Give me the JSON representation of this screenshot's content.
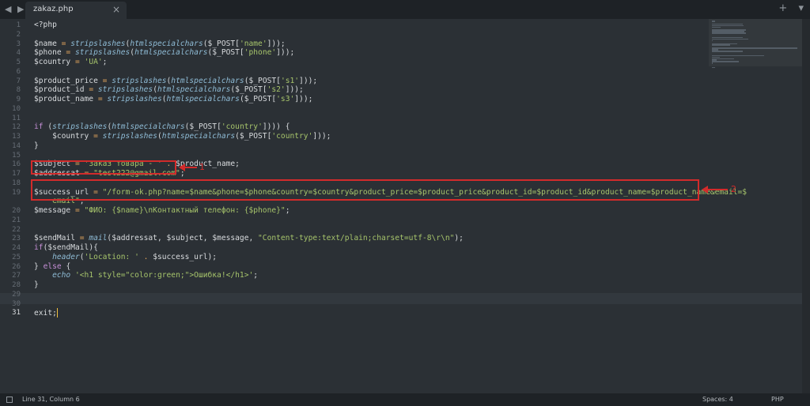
{
  "tab": {
    "filename": "zakaz.php",
    "close": "×",
    "nav": "◀ ▶"
  },
  "tab_actions": {
    "add": "+",
    "menu": "▾"
  },
  "code": {
    "lines": [
      {
        "n": "1",
        "tokens": [
          {
            "t": "<?php",
            "c": "v"
          }
        ]
      },
      {
        "n": "2",
        "tokens": []
      },
      {
        "n": "3",
        "tokens": [
          {
            "t": "$name",
            "c": "v"
          },
          {
            "t": " = ",
            "c": "o"
          },
          {
            "t": "stripslashes",
            "c": "f"
          },
          {
            "t": "(",
            "c": "v"
          },
          {
            "t": "htmlspecialchars",
            "c": "f"
          },
          {
            "t": "($_POST[",
            "c": "v"
          },
          {
            "t": "'name'",
            "c": "s"
          },
          {
            "t": "]));",
            "c": "v"
          }
        ]
      },
      {
        "n": "4",
        "tokens": [
          {
            "t": "$phone",
            "c": "v"
          },
          {
            "t": " = ",
            "c": "o"
          },
          {
            "t": "stripslashes",
            "c": "f"
          },
          {
            "t": "(",
            "c": "v"
          },
          {
            "t": "htmlspecialchars",
            "c": "f"
          },
          {
            "t": "($_POST[",
            "c": "v"
          },
          {
            "t": "'phone'",
            "c": "s"
          },
          {
            "t": "]));",
            "c": "v"
          }
        ]
      },
      {
        "n": "5",
        "tokens": [
          {
            "t": "$country",
            "c": "v"
          },
          {
            "t": " = ",
            "c": "o"
          },
          {
            "t": "'UA'",
            "c": "s"
          },
          {
            "t": ";",
            "c": "v"
          }
        ]
      },
      {
        "n": "6",
        "tokens": []
      },
      {
        "n": "7",
        "tokens": [
          {
            "t": "$product_price",
            "c": "v"
          },
          {
            "t": " = ",
            "c": "o"
          },
          {
            "t": "stripslashes",
            "c": "f"
          },
          {
            "t": "(",
            "c": "v"
          },
          {
            "t": "htmlspecialchars",
            "c": "f"
          },
          {
            "t": "($_POST[",
            "c": "v"
          },
          {
            "t": "'s1'",
            "c": "s"
          },
          {
            "t": "]));",
            "c": "v"
          }
        ]
      },
      {
        "n": "8",
        "tokens": [
          {
            "t": "$product_id",
            "c": "v"
          },
          {
            "t": " = ",
            "c": "o"
          },
          {
            "t": "stripslashes",
            "c": "f"
          },
          {
            "t": "(",
            "c": "v"
          },
          {
            "t": "htmlspecialchars",
            "c": "f"
          },
          {
            "t": "($_POST[",
            "c": "v"
          },
          {
            "t": "'s2'",
            "c": "s"
          },
          {
            "t": "]));",
            "c": "v"
          }
        ]
      },
      {
        "n": "9",
        "tokens": [
          {
            "t": "$product_name",
            "c": "v"
          },
          {
            "t": " = ",
            "c": "o"
          },
          {
            "t": "stripslashes",
            "c": "f"
          },
          {
            "t": "(",
            "c": "v"
          },
          {
            "t": "htmlspecialchars",
            "c": "f"
          },
          {
            "t": "($_POST[",
            "c": "v"
          },
          {
            "t": "'s3'",
            "c": "s"
          },
          {
            "t": "]));",
            "c": "v"
          }
        ]
      },
      {
        "n": "10",
        "tokens": []
      },
      {
        "n": "11",
        "tokens": []
      },
      {
        "n": "12",
        "tokens": [
          {
            "t": "if",
            "c": "k"
          },
          {
            "t": " (",
            "c": "v"
          },
          {
            "t": "stripslashes",
            "c": "f"
          },
          {
            "t": "(",
            "c": "v"
          },
          {
            "t": "htmlspecialchars",
            "c": "f"
          },
          {
            "t": "($_POST[",
            "c": "v"
          },
          {
            "t": "'country'",
            "c": "s"
          },
          {
            "t": "]))) {",
            "c": "v"
          }
        ]
      },
      {
        "n": "13",
        "tokens": [
          {
            "t": "    $country",
            "c": "v"
          },
          {
            "t": " = ",
            "c": "o"
          },
          {
            "t": "stripslashes",
            "c": "f"
          },
          {
            "t": "(",
            "c": "v"
          },
          {
            "t": "htmlspecialchars",
            "c": "f"
          },
          {
            "t": "($_POST[",
            "c": "v"
          },
          {
            "t": "'country'",
            "c": "s"
          },
          {
            "t": "]));",
            "c": "v"
          }
        ]
      },
      {
        "n": "14",
        "tokens": [
          {
            "t": "}",
            "c": "v"
          }
        ]
      },
      {
        "n": "15",
        "tokens": []
      },
      {
        "n": "16",
        "tokens": [
          {
            "t": "$subject",
            "c": "v"
          },
          {
            "t": " = ",
            "c": "o"
          },
          {
            "t": "'Заказ товара - '",
            "c": "s"
          },
          {
            "t": " . ",
            "c": "o"
          },
          {
            "t": "$product_name;",
            "c": "v"
          }
        ]
      },
      {
        "n": "17",
        "tokens": [
          {
            "t": "$addressat",
            "c": "v"
          },
          {
            "t": " = ",
            "c": "o"
          },
          {
            "t": "\"test222@gmail.com\"",
            "c": "s"
          },
          {
            "t": ";",
            "c": "v"
          }
        ]
      },
      {
        "n": "18",
        "tokens": []
      },
      {
        "n": "19",
        "tokens": [
          {
            "t": "$success_url",
            "c": "v"
          },
          {
            "t": " = ",
            "c": "o"
          },
          {
            "t": "\"/form-ok.php?name=$name&phone=$phone&country=$country&product_price=$product_price&product_id=$product_id&product_name=$product_name&email=$",
            "c": "s"
          }
        ]
      },
      {
        "n": "",
        "tokens": [
          {
            "t": "    email\"",
            "c": "s"
          },
          {
            "t": ";",
            "c": "v"
          }
        ]
      },
      {
        "n": "20",
        "tokens": [
          {
            "t": "$message",
            "c": "v"
          },
          {
            "t": " = ",
            "c": "o"
          },
          {
            "t": "\"ФИО: {$name}\\nКонтактный телефон: {$phone}\"",
            "c": "s"
          },
          {
            "t": ";",
            "c": "v"
          }
        ]
      },
      {
        "n": "21",
        "tokens": []
      },
      {
        "n": "22",
        "tokens": []
      },
      {
        "n": "23",
        "tokens": [
          {
            "t": "$sendMail",
            "c": "v"
          },
          {
            "t": " = ",
            "c": "o"
          },
          {
            "t": "mail",
            "c": "f"
          },
          {
            "t": "($addressat, $subject, $message, ",
            "c": "v"
          },
          {
            "t": "\"Content-type:text/plain;charset=utf-8\\r\\n\"",
            "c": "s"
          },
          {
            "t": ");",
            "c": "v"
          }
        ]
      },
      {
        "n": "24",
        "tokens": [
          {
            "t": "if",
            "c": "k"
          },
          {
            "t": "($sendMail){",
            "c": "v"
          }
        ]
      },
      {
        "n": "25",
        "tokens": [
          {
            "t": "    ",
            "c": "v"
          },
          {
            "t": "header",
            "c": "f"
          },
          {
            "t": "(",
            "c": "v"
          },
          {
            "t": "'Location: '",
            "c": "s"
          },
          {
            "t": " . ",
            "c": "o"
          },
          {
            "t": "$success_url);",
            "c": "v"
          }
        ]
      },
      {
        "n": "26",
        "tokens": [
          {
            "t": "} ",
            "c": "v"
          },
          {
            "t": "else",
            "c": "k"
          },
          {
            "t": " {",
            "c": "v"
          }
        ]
      },
      {
        "n": "27",
        "tokens": [
          {
            "t": "    ",
            "c": "v"
          },
          {
            "t": "echo",
            "c": "f"
          },
          {
            "t": " ",
            "c": "v"
          },
          {
            "t": "'<h1 style=\"color:green;\">Ошибка!</h1>'",
            "c": "s"
          },
          {
            "t": ";",
            "c": "v"
          }
        ]
      },
      {
        "n": "28",
        "tokens": [
          {
            "t": "}",
            "c": "v"
          }
        ]
      },
      {
        "n": "29",
        "tokens": []
      },
      {
        "n": "30",
        "tokens": []
      },
      {
        "n": "31",
        "tokens": [
          {
            "t": "exit",
            "c": "v"
          },
          {
            "t": ";",
            "c": "v"
          }
        ],
        "active": true
      }
    ]
  },
  "annotations": {
    "first": "1",
    "second": "2"
  },
  "status": {
    "position": "Line 31, Column 6",
    "spaces": "Spaces: 4",
    "language": "PHP"
  }
}
